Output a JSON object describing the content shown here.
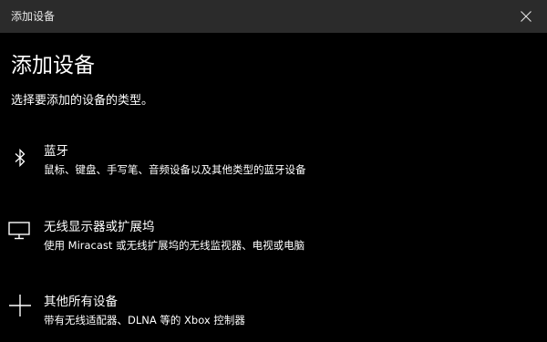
{
  "window": {
    "title": "添加设备",
    "close_icon": "close-icon"
  },
  "main": {
    "heading": "添加设备",
    "subheading": "选择要添加的设备的类型。"
  },
  "options": [
    {
      "icon": "bluetooth-icon",
      "title": "蓝牙",
      "description": "鼠标、键盘、手写笔、音频设备以及其他类型的蓝牙设备"
    },
    {
      "icon": "monitor-icon",
      "title": "无线显示器或扩展坞",
      "description": "使用 Miracast 或无线扩展坞的无线监视器、电视或电脑"
    },
    {
      "icon": "plus-icon",
      "title": "其他所有设备",
      "description": "带有无线适配器、DLNA 等的 Xbox 控制器"
    }
  ],
  "colors": {
    "background": "#000000",
    "titlebar": "#2b2b2b",
    "text": "#ffffff"
  }
}
